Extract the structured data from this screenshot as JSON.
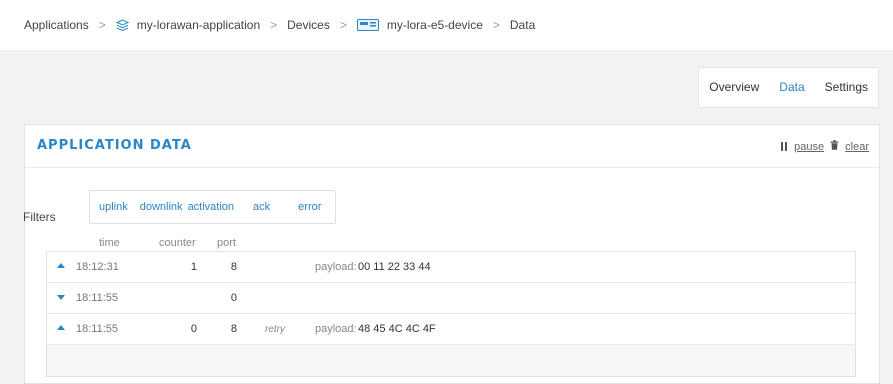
{
  "breadcrumb": {
    "applications": "Applications",
    "application": "my-lorawan-application",
    "devices": "Devices",
    "device": "my-lora-e5-device",
    "data": "Data",
    "separator": ">"
  },
  "tabs": [
    {
      "label": "Overview"
    },
    {
      "label": "Data",
      "active": true
    },
    {
      "label": "Settings"
    }
  ],
  "card": {
    "title": "APPLICATION DATA",
    "pause_label": "pause",
    "clear_label": "clear"
  },
  "filters": {
    "label": "Filters",
    "items": [
      "uplink",
      "downlink",
      "activation",
      "ack",
      "error"
    ]
  },
  "columns": {
    "time": "time",
    "counter": "counter",
    "port": "port"
  },
  "rows": [
    {
      "direction": "up",
      "time": "18:12:31",
      "counter": "1",
      "port": "8",
      "retry": "",
      "payload_label": "payload:",
      "payload": "00 11 22 33 44"
    },
    {
      "direction": "down",
      "time": "18:11:55",
      "counter": "",
      "port": "0",
      "retry": "",
      "payload_label": "",
      "payload": ""
    },
    {
      "direction": "up",
      "time": "18:11:55",
      "counter": "0",
      "port": "8",
      "retry": "retry",
      "payload_label": "payload:",
      "payload": "48 45 4C 4C 4F"
    }
  ],
  "colors": {
    "accent": "#2b86c5",
    "background": "#f3f3f3"
  },
  "icons": {
    "application": "cube-stack-icon",
    "device": "device-board-icon",
    "pause": "pause-icon",
    "clear": "trash-icon"
  }
}
